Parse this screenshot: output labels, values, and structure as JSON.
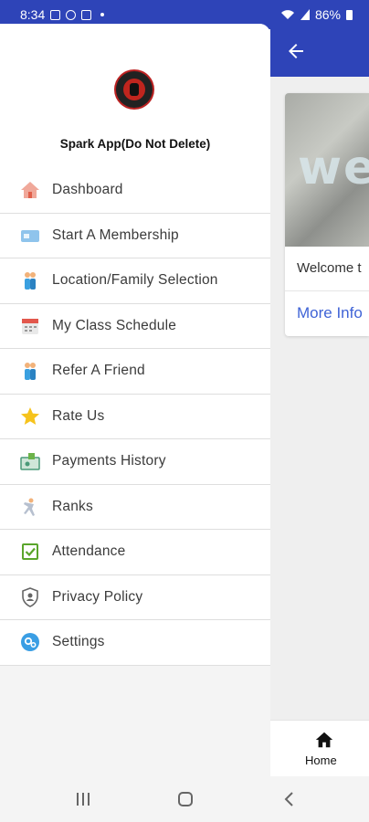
{
  "status_bar": {
    "time": "8:34",
    "battery": "86%"
  },
  "drawer": {
    "org_name": "Spark App(Do Not Delete)",
    "menu": [
      {
        "label": "Dashboard",
        "icon": "house-icon"
      },
      {
        "label": "Start A Membership",
        "icon": "card-icon"
      },
      {
        "label": "Location/Family Selection",
        "icon": "family-icon"
      },
      {
        "label": "My Class Schedule",
        "icon": "calendar-icon"
      },
      {
        "label": "Refer A Friend",
        "icon": "friends-icon"
      },
      {
        "label": "Rate Us",
        "icon": "star-icon"
      },
      {
        "label": "Payments History",
        "icon": "payment-icon"
      },
      {
        "label": "Ranks",
        "icon": "karate-icon"
      },
      {
        "label": "Attendance",
        "icon": "checkbox-icon"
      },
      {
        "label": "Privacy Policy",
        "icon": "shield-icon"
      },
      {
        "label": "Settings",
        "icon": "gear-icon"
      }
    ]
  },
  "main": {
    "card": {
      "image_text": "we",
      "text": "Welcome t",
      "link": "More Info"
    },
    "bottom_nav": {
      "home_label": "Home"
    }
  },
  "colors": {
    "primary": "#2e44b8",
    "link": "#3f63d6"
  }
}
